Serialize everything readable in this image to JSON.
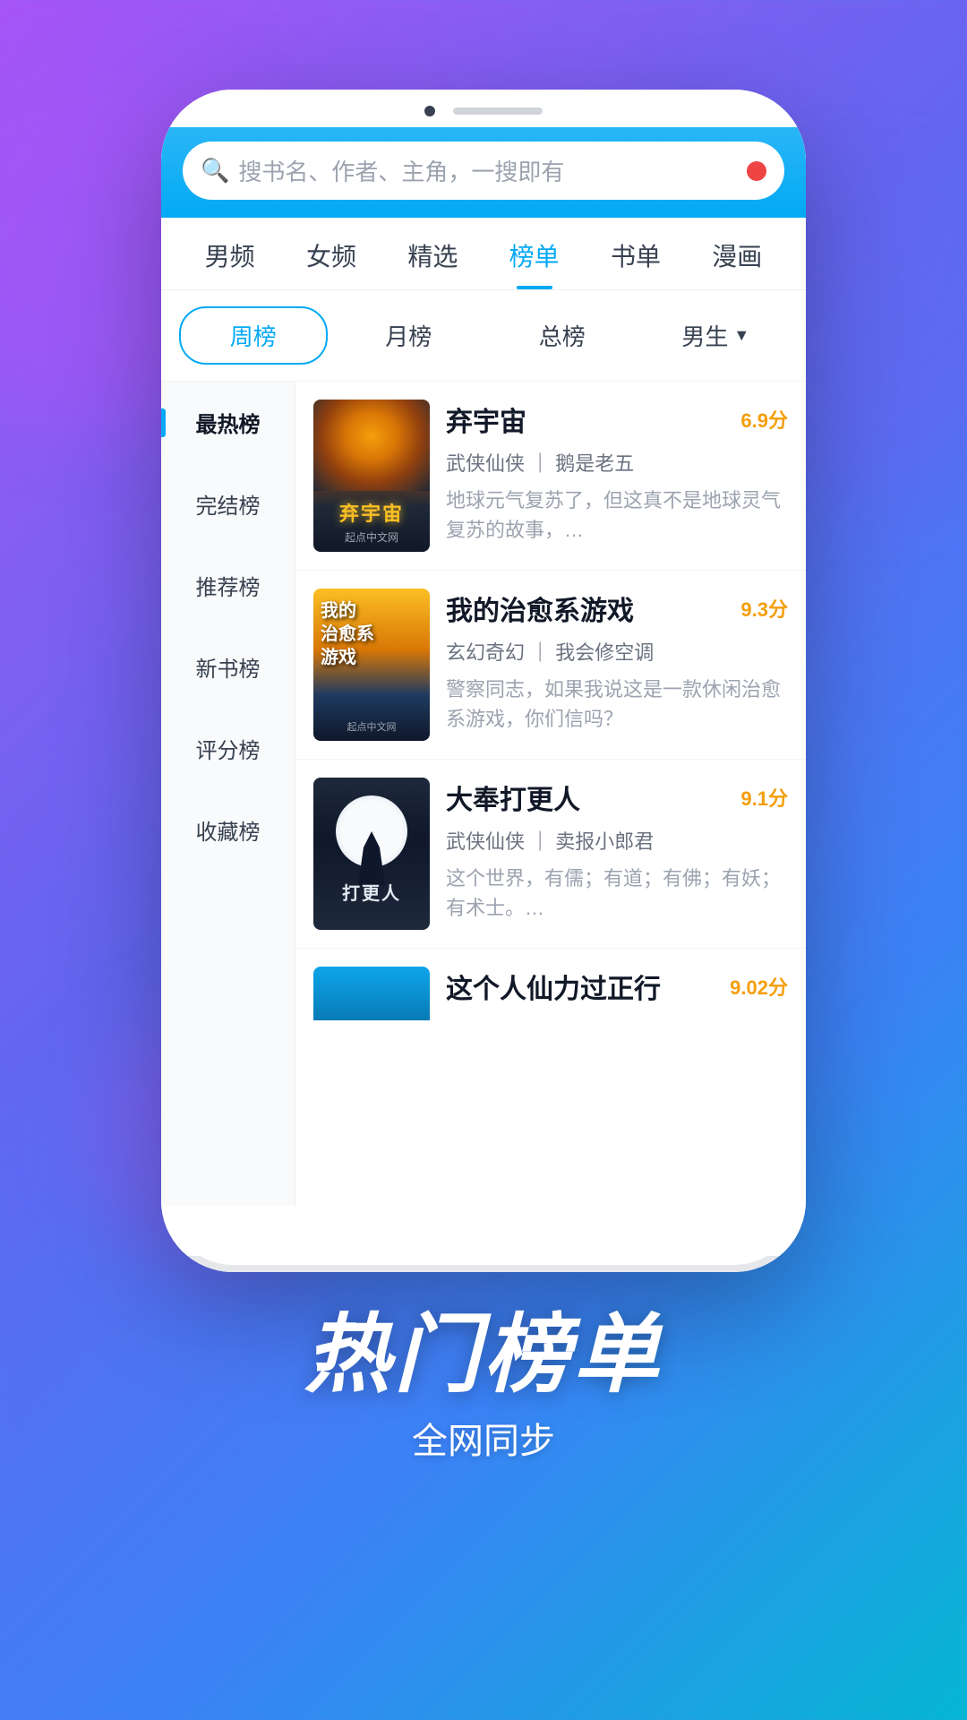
{
  "background": {
    "gradient": "135deg, #a855f7 0%, #6366f1 40%, #3b82f6 70%, #06b6d4 100%"
  },
  "phone": {
    "search": {
      "placeholder": "搜书名、作者、主角，一搜即有"
    },
    "nav_tabs": [
      {
        "label": "男频",
        "active": false
      },
      {
        "label": "女频",
        "active": false
      },
      {
        "label": "精选",
        "active": false
      },
      {
        "label": "榜单",
        "active": true
      },
      {
        "label": "书单",
        "active": false
      },
      {
        "label": "漫画",
        "active": false
      }
    ],
    "sub_tabs": [
      {
        "label": "周榜",
        "active": true
      },
      {
        "label": "月榜",
        "active": false
      },
      {
        "label": "总榜",
        "active": false
      },
      {
        "label": "男生",
        "active": false,
        "has_dropdown": true
      }
    ],
    "sidebar": {
      "items": [
        {
          "label": "最热榜",
          "active": true
        },
        {
          "label": "完结榜",
          "active": false
        },
        {
          "label": "推荐榜",
          "active": false
        },
        {
          "label": "新书榜",
          "active": false
        },
        {
          "label": "评分榜",
          "active": false
        },
        {
          "label": "收藏榜",
          "active": false
        }
      ]
    },
    "books": [
      {
        "title": "弃宇宙",
        "score": "6.9",
        "score_unit": "分",
        "genre": "武侠仙侠",
        "author": "鹅是老五",
        "description": "地球元气复苏了，但这真不是地球灵气复苏的故事，…"
      },
      {
        "title": "我的治愈系游戏",
        "score": "9.3",
        "score_unit": "分",
        "genre": "玄幻奇幻",
        "author": "我会修空调",
        "description": "警察同志，如果我说这是一款休闲治愈系游戏，你们信吗？"
      },
      {
        "title": "大奉打更人",
        "score": "9.1",
        "score_unit": "分",
        "genre": "武侠仙侠",
        "author": "卖报小郎君",
        "description": "这个世界，有儒；有道；有佛；有妖；有术士。…"
      },
      {
        "title": "这个人仙力过正行",
        "score": "9.02",
        "score_unit": "分",
        "genre": "",
        "author": "",
        "description": ""
      }
    ]
  },
  "banner": {
    "title": "热门榜单",
    "subtitle": "全网同步"
  }
}
